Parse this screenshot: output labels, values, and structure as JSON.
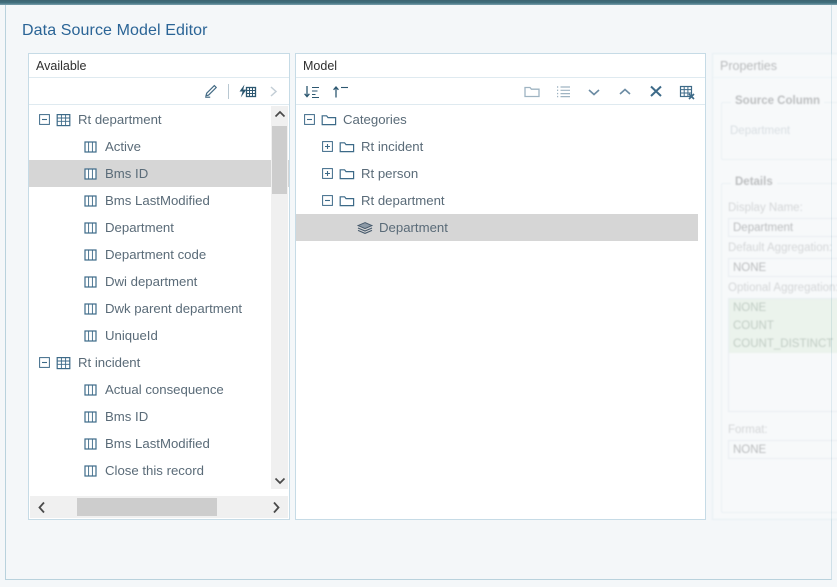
{
  "window": {
    "title": "Data Source Model Editor"
  },
  "available": {
    "header": "Available",
    "toolbar": [
      {
        "name": "edit-pencil-icon",
        "label": "Edit"
      },
      {
        "name": "generate-table-icon",
        "label": "Auto generate"
      },
      {
        "name": "chevron-right-icon",
        "label": "Add to model"
      }
    ],
    "tree": [
      {
        "label": "Rt department",
        "level": 0,
        "icon": "table-icon",
        "expander": "minus",
        "selected": false
      },
      {
        "label": "Active",
        "level": 1,
        "icon": "column-icon",
        "expander": "none",
        "selected": false
      },
      {
        "label": "Bms ID",
        "level": 1,
        "icon": "column-icon",
        "expander": "none",
        "selected": true
      },
      {
        "label": "Bms LastModified",
        "level": 1,
        "icon": "column-icon",
        "expander": "none",
        "selected": false
      },
      {
        "label": "Department",
        "level": 1,
        "icon": "column-icon",
        "expander": "none",
        "selected": false
      },
      {
        "label": "Department code",
        "level": 1,
        "icon": "column-icon",
        "expander": "none",
        "selected": false
      },
      {
        "label": "Dwi department",
        "level": 1,
        "icon": "column-icon",
        "expander": "none",
        "selected": false
      },
      {
        "label": "Dwk parent department",
        "level": 1,
        "icon": "column-icon",
        "expander": "none",
        "selected": false
      },
      {
        "label": "UniqueId",
        "level": 1,
        "icon": "column-icon",
        "expander": "none",
        "selected": false
      },
      {
        "label": "Rt incident",
        "level": 0,
        "icon": "table-icon",
        "expander": "minus",
        "selected": false
      },
      {
        "label": "Actual consequence",
        "level": 1,
        "icon": "column-icon",
        "expander": "none",
        "selected": false
      },
      {
        "label": "Bms ID",
        "level": 1,
        "icon": "column-icon",
        "expander": "none",
        "selected": false
      },
      {
        "label": "Bms LastModified",
        "level": 1,
        "icon": "column-icon",
        "expander": "none",
        "selected": false
      },
      {
        "label": "Close this record",
        "level": 1,
        "icon": "column-icon",
        "expander": "none",
        "selected": false
      }
    ]
  },
  "model": {
    "header": "Model",
    "toolbar_left": [
      {
        "name": "sort-descending-icon",
        "label": "Sort descending"
      },
      {
        "name": "sort-ascending-icon",
        "label": "Sort ascending"
      }
    ],
    "toolbar_right": [
      {
        "name": "new-folder-icon",
        "label": "New folder"
      },
      {
        "name": "list-icon",
        "label": "List"
      },
      {
        "name": "chevron-down-icon",
        "label": "Move down"
      },
      {
        "name": "chevron-up-icon",
        "label": "Move up"
      },
      {
        "name": "close-icon",
        "label": "Remove"
      },
      {
        "name": "remove-table-icon",
        "label": "Remove table"
      }
    ],
    "tree": [
      {
        "label": "Categories",
        "level": 0,
        "icon": "folder-icon",
        "expander": "minus",
        "selected": false
      },
      {
        "label": "Rt incident",
        "level": 1,
        "icon": "folder-icon",
        "expander": "plus",
        "selected": false
      },
      {
        "label": "Rt person",
        "level": 1,
        "icon": "folder-icon",
        "expander": "plus",
        "selected": false
      },
      {
        "label": "Rt department",
        "level": 1,
        "icon": "folder-icon",
        "expander": "minus",
        "selected": false
      },
      {
        "label": "Department",
        "level": 2,
        "icon": "layers-icon",
        "expander": "none",
        "selected": true
      }
    ]
  },
  "properties": {
    "header": "Properties",
    "source_column": {
      "legend": "Source Column",
      "value": "Department"
    },
    "details": {
      "legend": "Details",
      "display_name_label": "Display Name:",
      "display_name_value": "Department",
      "default_aggregation_label": "Default Aggregation:",
      "default_aggregation_value": "NONE",
      "optional_aggregation_label": "Optional Aggregation:",
      "optional_aggregation_options": [
        "NONE",
        "COUNT",
        "COUNT_DISTINCT"
      ],
      "format_label": "Format:",
      "format_value": "NONE"
    }
  },
  "colors": {
    "title": "#2a6496",
    "panel_border": "#c6dbe6",
    "selection": "#d6d6d6",
    "icon": "#436a84",
    "aggregation_highlight": "#d8ead0",
    "top_strip": "#41707e"
  }
}
